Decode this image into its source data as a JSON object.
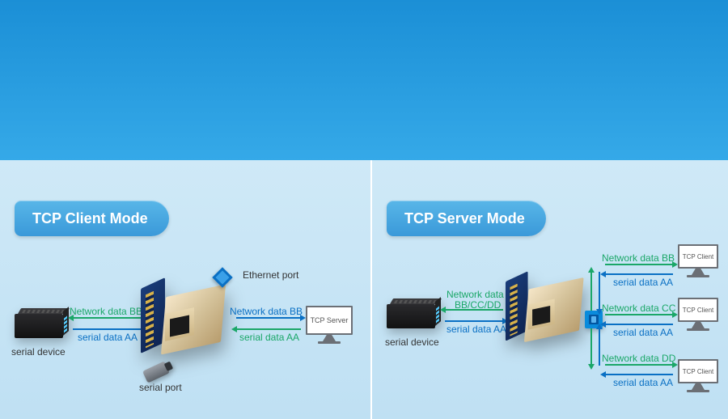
{
  "left_panel": {
    "title": "TCP Client Mode",
    "serial_device_label": "serial device",
    "serial_port_label": "serial port",
    "ethernet_port_label": "Ethernet port",
    "net_label_left": "Network data BB",
    "ser_label_left": "serial data AA",
    "net_label_right": "Network data BB",
    "ser_label_right": "serial data AA",
    "monitor_label": "TCP Server"
  },
  "right_panel": {
    "title": "TCP Server Mode",
    "serial_device_label": "serial device",
    "net_label_multi": "Network data",
    "net_label_multi_sub": "BB/CC/DD",
    "ser_label_left": "serial data AA",
    "clients": [
      {
        "net": "Network data BB",
        "ser": "serial data AA",
        "mon": "TCP Client"
      },
      {
        "net": "Network data CC",
        "ser": "serial data AA",
        "mon": "TCP Client"
      },
      {
        "net": "Network data DD",
        "ser": "serial data AA",
        "mon": "TCP Client"
      }
    ]
  }
}
